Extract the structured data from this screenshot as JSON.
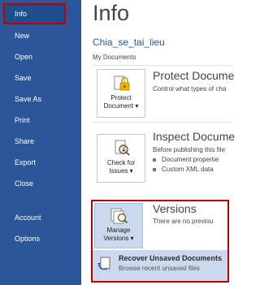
{
  "sidebar": {
    "items": [
      {
        "label": "Info"
      },
      {
        "label": "New"
      },
      {
        "label": "Open"
      },
      {
        "label": "Save"
      },
      {
        "label": "Save As"
      },
      {
        "label": "Print"
      },
      {
        "label": "Share"
      },
      {
        "label": "Export"
      },
      {
        "label": "Close"
      },
      {
        "label": "Account"
      },
      {
        "label": "Options"
      }
    ]
  },
  "main": {
    "title": "Info",
    "doc_name": "Chia_se_tai_lieu",
    "doc_path": "My Documents",
    "protect": {
      "button_label_1": "Protect",
      "button_label_2": "Document ▾",
      "title": "Protect Docume",
      "desc": "Control what types of cha"
    },
    "inspect": {
      "button_label_1": "Check for",
      "button_label_2": "Issues ▾",
      "title": "Inspect Docume",
      "desc": "Before publishing this file",
      "bullets": [
        "Document propertie",
        "Custom XML data"
      ]
    },
    "versions": {
      "button_label_1": "Manage",
      "button_label_2": "Versions ▾",
      "title": "Versions",
      "desc": "There are no previou",
      "recover_title": "Recover Unsaved Documents",
      "recover_sub": "Browse recent unsaved files"
    }
  },
  "colors": {
    "sidebar_bg": "#2b579a",
    "highlight_border": "#c00000",
    "dropdown_bg": "#cbd9ef"
  }
}
